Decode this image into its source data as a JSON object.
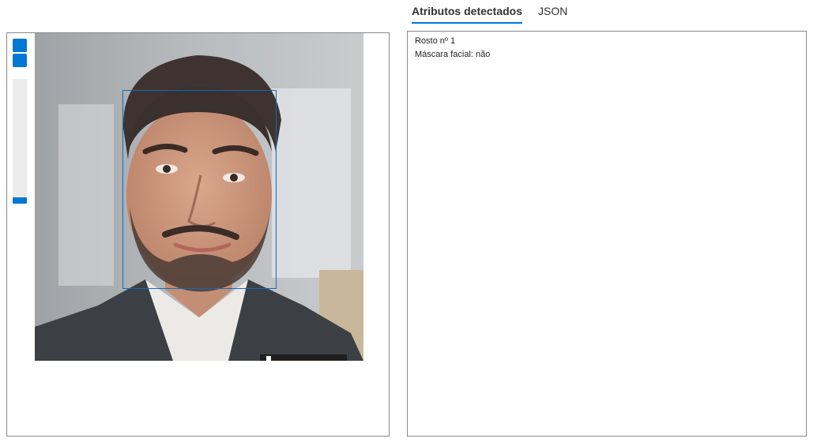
{
  "tabs": [
    {
      "label": "Atributos detectados",
      "active": true
    },
    {
      "label": "JSON",
      "active": false
    }
  ],
  "viewer": {
    "zoom_in_icon": "zoom-in-icon",
    "zoom_out_icon": "zoom-out-icon",
    "image_description": "Portrait photo of a smiling bearded man in a dark suit and white shirt",
    "face_box_color": "#0f6cbd"
  },
  "results": {
    "face_label": "Rosto nº 1",
    "mask_label": "Máscara facial: não"
  },
  "colors": {
    "accent": "#0078d4",
    "border": "#8a8886"
  }
}
